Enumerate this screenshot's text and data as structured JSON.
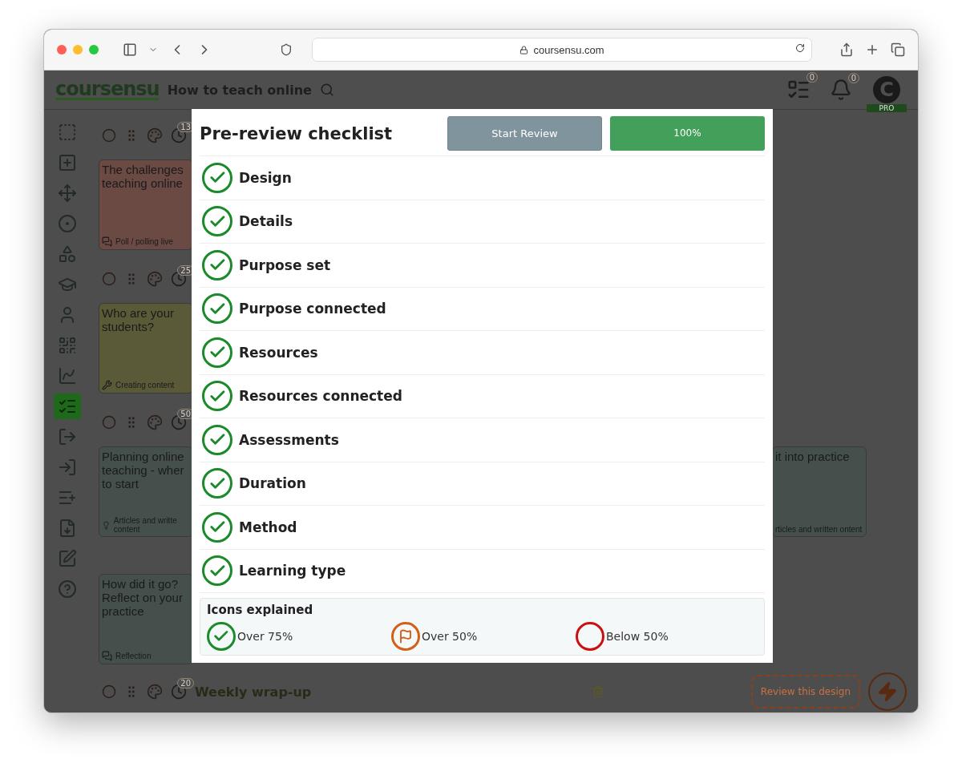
{
  "browser": {
    "url": "coursensu.com"
  },
  "header": {
    "logo": "coursensu",
    "title": "How to teach online",
    "list_badge": "0",
    "bell_badge": "0",
    "avatar": "C",
    "plan": "PRO"
  },
  "sidebar": {
    "tools": [
      {
        "selected": false
      },
      {
        "selected": false
      },
      {
        "selected": false
      },
      {
        "selected": false
      },
      {
        "selected": false
      },
      {
        "selected": false
      },
      {
        "selected": false
      },
      {
        "selected": false
      },
      {
        "selected": false
      },
      {
        "selected": true
      },
      {
        "selected": false
      },
      {
        "selected": false
      },
      {
        "selected": false
      },
      {
        "selected": false
      },
      {
        "selected": false
      },
      {
        "selected": false
      }
    ]
  },
  "rows": [
    {
      "badge": "13",
      "cards": [
        {
          "title": "The challenges teaching online",
          "category": "Poll / polling live",
          "kind": "poll",
          "color": "#6b4a44"
        }
      ]
    },
    {
      "badge": "25",
      "cards": [
        {
          "title": "Who are your students?",
          "category": "Creating content",
          "kind": "tool",
          "color": "#5a5a38"
        }
      ]
    },
    {
      "badge": "50",
      "cards": [
        {
          "title": "Planning online teaching - wher to start",
          "category": "Articles and writte content",
          "kind": "idea",
          "color": "#45504d"
        },
        {
          "title": "it into practice",
          "category": "rticles and written ontent",
          "kind": "none",
          "color": "#45504d"
        }
      ]
    },
    {
      "cards": [
        {
          "title": "How did it go? Reflect on your practice",
          "category": "Reflection",
          "kind": "poll",
          "color": "#45504d"
        }
      ]
    }
  ],
  "wrap_up": {
    "badge": "20",
    "title": "Weekly wrap-up"
  },
  "review_button": "Review this design",
  "modal": {
    "title": "Pre-review checklist",
    "start_button": "Start Review",
    "progress": {
      "level": 1,
      "label": "100%"
    },
    "items": [
      {
        "label": "Design",
        "kind": "check"
      },
      {
        "label": "Details",
        "kind": "check"
      },
      {
        "label": "Purpose set",
        "kind": "check"
      },
      {
        "label": "Purpose connected",
        "kind": "check"
      },
      {
        "label": "Resources",
        "kind": "check"
      },
      {
        "label": "Resources connected",
        "kind": "check"
      },
      {
        "label": "Assessments",
        "kind": "check"
      },
      {
        "label": "Duration",
        "kind": "check"
      },
      {
        "label": "Method",
        "kind": "check"
      },
      {
        "label": "Learning type",
        "kind": "check"
      }
    ],
    "legend": {
      "title": "Icons explained",
      "items": [
        {
          "label": "Over 75%",
          "kind": "check"
        },
        {
          "label": "Over 50%",
          "kind": "flag"
        },
        {
          "label": "Below 50%",
          "kind": "empty"
        }
      ]
    }
  }
}
